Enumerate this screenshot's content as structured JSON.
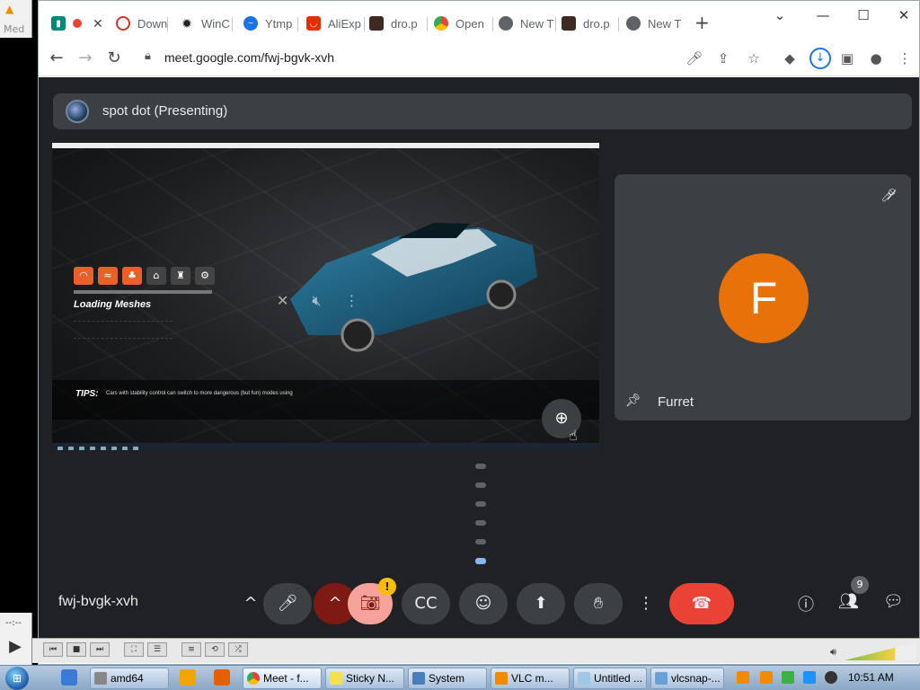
{
  "vlc": {
    "label": "Med",
    "time": "--:--"
  },
  "browser": {
    "tabs": [
      {
        "label": "",
        "icon": "google-meet-icon",
        "active": true
      },
      {
        "label": "Down",
        "icon": "red-circle-icon"
      },
      {
        "label": "WinC",
        "icon": "gear-icon"
      },
      {
        "label": "Ytmp",
        "icon": "blue-circle-icon"
      },
      {
        "label": "AliExp",
        "icon": "aliexpress-icon"
      },
      {
        "label": "dro.p",
        "icon": "page-icon"
      },
      {
        "label": "Open",
        "icon": "chrome-icon"
      },
      {
        "label": "New T",
        "icon": "chrome-icon"
      },
      {
        "label": "dro.p",
        "icon": "page-icon"
      },
      {
        "label": "New T",
        "icon": "chrome-icon"
      }
    ],
    "url": "meet.google.com/fwj-bgvk-xvh"
  },
  "meet": {
    "presenter_label": "spot dot (Presenting)",
    "shared_screen": {
      "loading_title": "Loading Meshes",
      "tips_label": "TIPS:",
      "tips_text": "Cars with stability control can switch to more dangerous (but fun) modes using"
    },
    "participant": {
      "initial": "F",
      "name": "Furret",
      "avatar_color": "#e8710a"
    },
    "meeting_code": "fwj-bvgk-xvh",
    "warning_badge": "!",
    "people_count": "9",
    "colors": {
      "end_call": "#ea4335",
      "background": "#202124",
      "tile": "#3c4043",
      "accent": "#8ab4f8"
    }
  },
  "taskbar": {
    "items": [
      {
        "label": "amd64"
      },
      {
        "label": "Meet - f..."
      },
      {
        "label": "Sticky N..."
      },
      {
        "label": "System"
      },
      {
        "label": "VLC m..."
      },
      {
        "label": "Untitled ..."
      },
      {
        "label": "vlcsnap-..."
      }
    ],
    "clock": "10:51 AM"
  }
}
